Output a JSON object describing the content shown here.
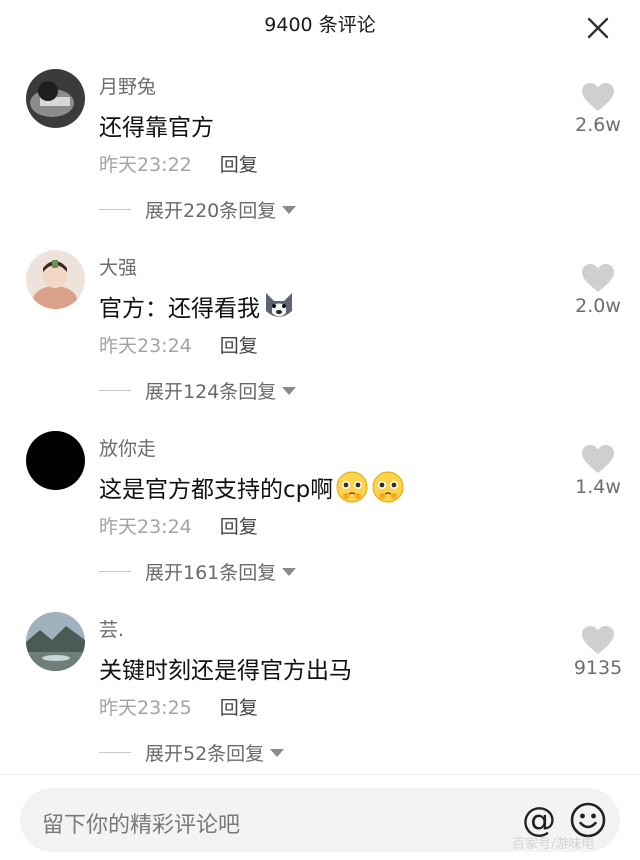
{
  "header": {
    "title": "9400 条评论"
  },
  "comments": [
    {
      "username": "月野兔",
      "text": "还得靠官方",
      "time": "昨天23:22",
      "reply_label": "回复",
      "expand_label": "展开220条回复",
      "likes": "2.6w",
      "avatar": "avatar-dark-photo"
    },
    {
      "username": "大强",
      "text": "官方：还得看我",
      "emoji": "husky-dog-emoji",
      "time": "昨天23:24",
      "reply_label": "回复",
      "expand_label": "展开124条回复",
      "likes": "2.0w",
      "avatar": "avatar-illustration"
    },
    {
      "username": "放你走",
      "text": "这是官方都支持的cp啊",
      "emoji": "pleading-face-emoji x2",
      "time": "昨天23:24",
      "reply_label": "回复",
      "expand_label": "展开161条回复",
      "likes": "1.4w",
      "avatar": "avatar-black"
    },
    {
      "username": "芸.",
      "text": "关键时刻还是得官方出马",
      "time": "昨天23:25",
      "reply_label": "回复",
      "expand_label": "展开52条回复",
      "likes": "9135",
      "avatar": "avatar-landscape"
    }
  ],
  "input": {
    "placeholder": "留下你的精彩评论吧"
  },
  "watermark": "百家号/游味电",
  "colors": {
    "like_heart": "#cfcfcf",
    "username": "#6d6d6d",
    "meta": "#a3a3a3"
  }
}
